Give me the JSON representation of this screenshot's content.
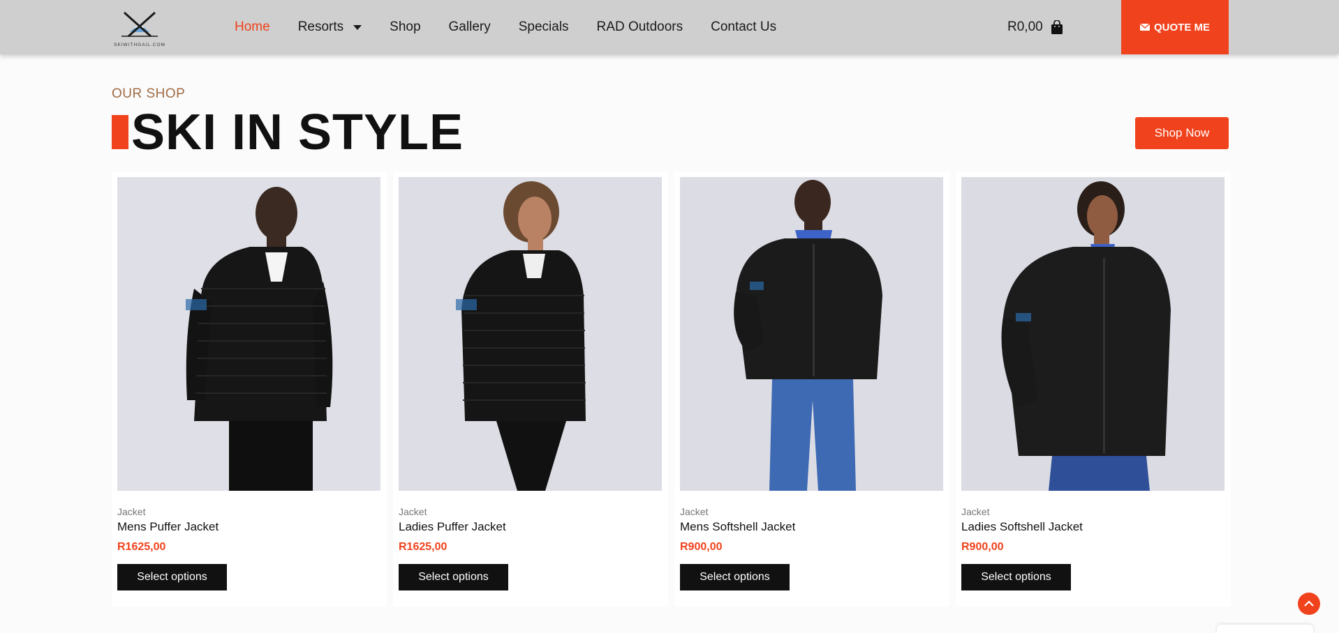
{
  "header": {
    "logo_text": "SKIWITHGAIL.COM",
    "nav": [
      {
        "label": "Home",
        "active": true
      },
      {
        "label": "Resorts",
        "has_dropdown": true
      },
      {
        "label": "Shop"
      },
      {
        "label": "Gallery"
      },
      {
        "label": "Specials"
      },
      {
        "label": "RAD Outdoors"
      },
      {
        "label": "Contact Us"
      }
    ],
    "cart_total": "R0,00",
    "quote_label": "QUOTE ME"
  },
  "section": {
    "eyebrow": "OUR SHOP",
    "title": "SKI IN STYLE",
    "shop_now": "Shop Now"
  },
  "products": [
    {
      "category": "Jacket",
      "name": "Mens Puffer Jacket",
      "price": "R1625,00",
      "button": "Select options"
    },
    {
      "category": "Jacket",
      "name": "Ladies Puffer Jacket",
      "price": "R1625,00",
      "button": "Select options"
    },
    {
      "category": "Jacket",
      "name": "Mens Softshell Jacket",
      "price": "R900,00",
      "button": "Select options"
    },
    {
      "category": "Jacket",
      "name": "Ladies Softshell Jacket",
      "price": "R900,00",
      "button": "Select options"
    }
  ],
  "colors": {
    "accent": "#f0421c",
    "header_bg": "#cfcfcf",
    "button_dark": "#111111",
    "eyebrow": "#a06a44"
  },
  "icons": {
    "logo": "crossed-skis-mountain-logo",
    "cart": "shopping-bag-icon",
    "quote": "envelope-icon",
    "dropdown": "caret-down-icon",
    "to_top": "chevron-up-icon"
  }
}
